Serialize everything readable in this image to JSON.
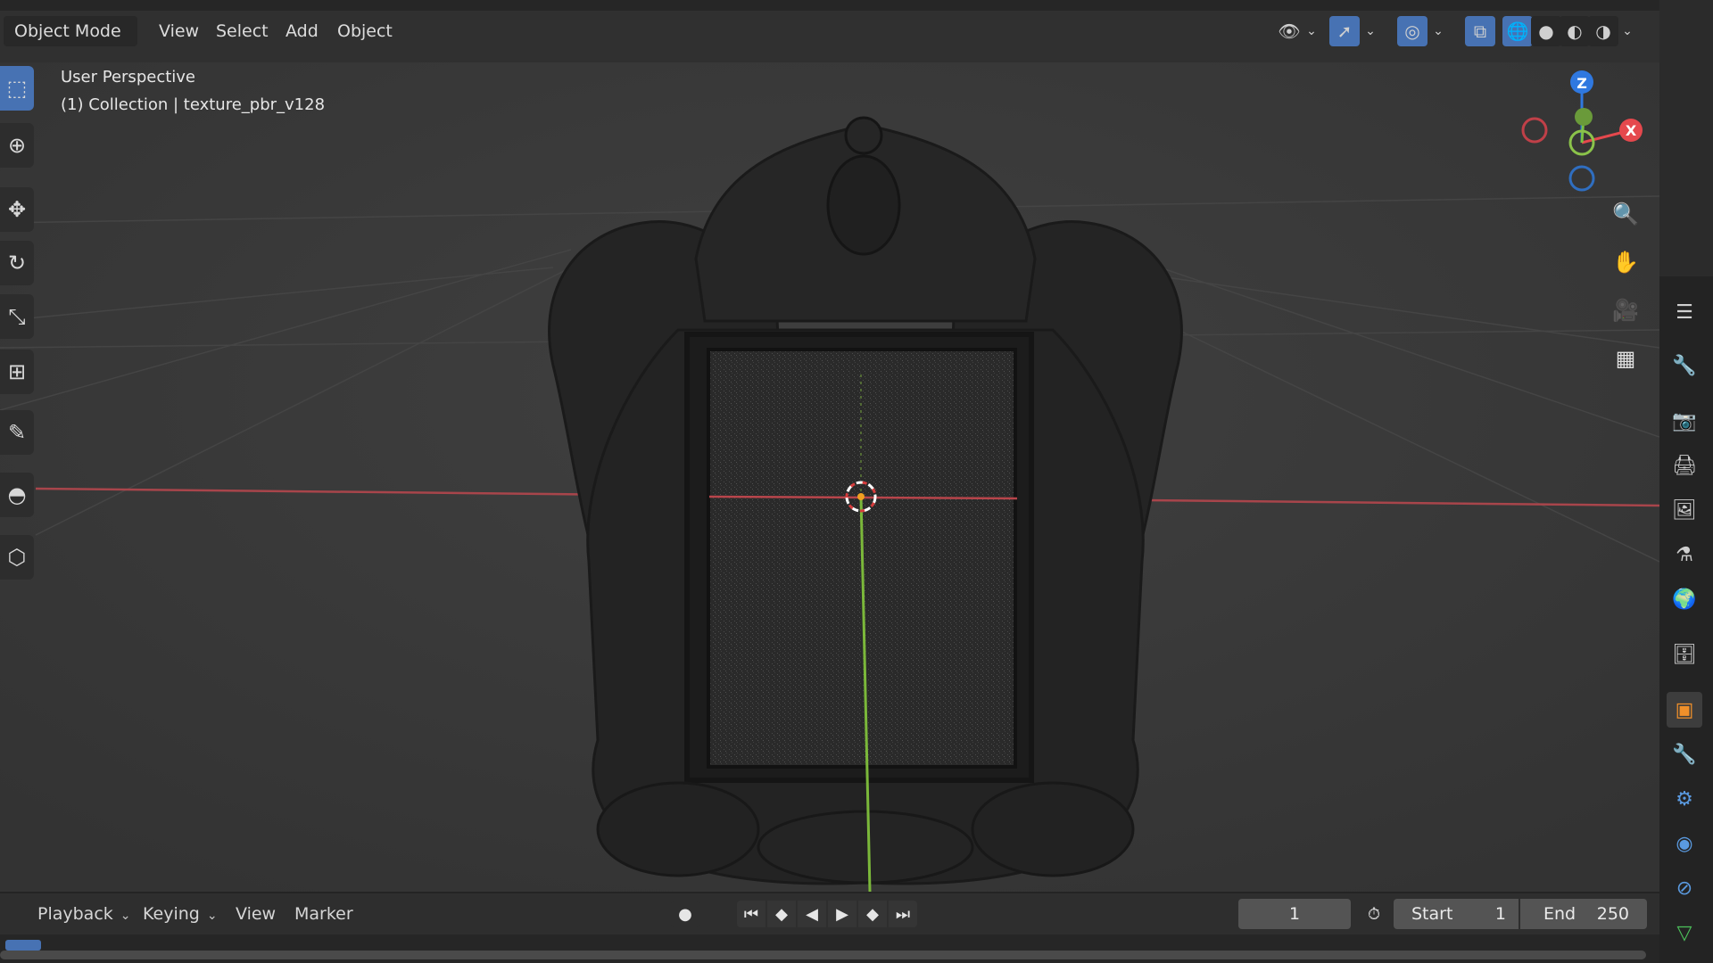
{
  "header": {
    "mode": "Object Mode",
    "menus": [
      "View",
      "Select",
      "Add",
      "Object"
    ]
  },
  "viewport": {
    "perspective_label": "User Perspective",
    "collection_label": "(1) Collection | texture_pbr_v128"
  },
  "gizmo": {
    "z_label": "Z",
    "x_label": "X",
    "colors": {
      "x": "#e5484d",
      "y": "#7ac142",
      "z": "#2f78e0"
    }
  },
  "timeline": {
    "menus": [
      "Playback",
      "Keying",
      "View",
      "Marker"
    ],
    "current_frame": "1",
    "start_label": "Start",
    "start_value": "1",
    "end_label": "End",
    "end_value": "250"
  },
  "icons": {
    "toolbar": [
      "select-box-icon",
      "cursor-icon",
      "move-icon",
      "rotate-icon",
      "scale-icon",
      "transform-icon",
      "annotate-icon",
      "measure-icon",
      "add-cube-icon"
    ],
    "nav": [
      "zoom-icon",
      "pan-hand-icon",
      "camera-icon",
      "grid-icon"
    ],
    "properties": [
      "tool-icon",
      "render-icon",
      "output-icon",
      "view-layer-icon",
      "scene-icon",
      "world-icon",
      "collection-icon",
      "object-icon",
      "modifier-icon",
      "particles-icon",
      "physics-icon",
      "constraints-icon",
      "data-icon"
    ]
  },
  "accent": "#4772b3"
}
